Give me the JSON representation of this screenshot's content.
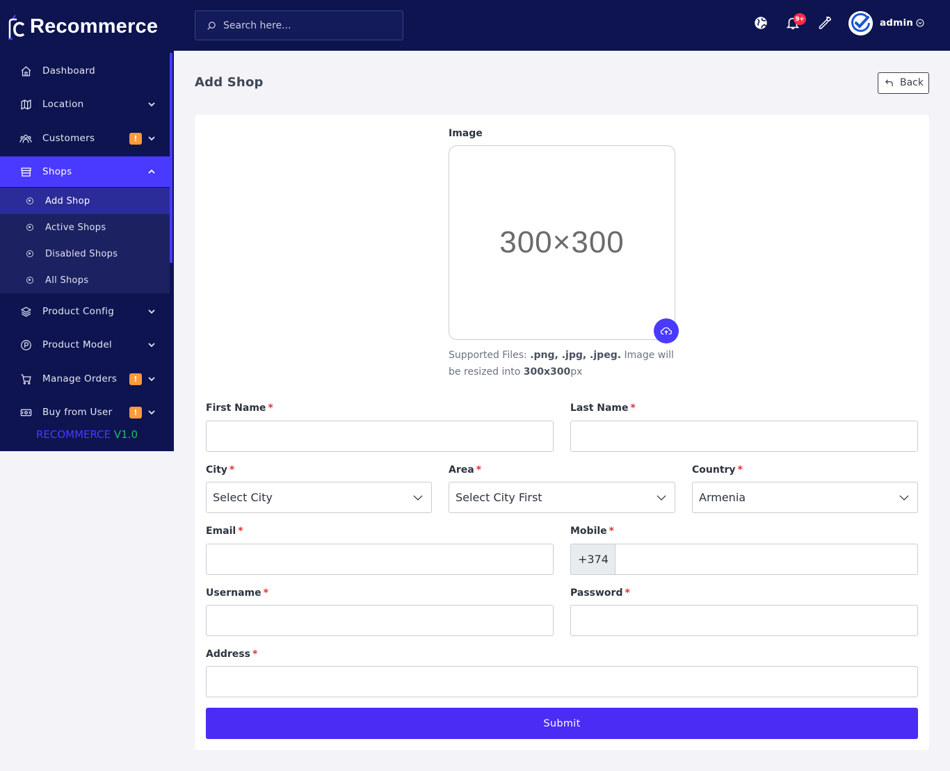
{
  "app": {
    "brand": "Recommerce",
    "version_name": "RECOMMERCE",
    "version_number": "V1.0"
  },
  "colors": {
    "sidebar_bg": "#0d1450",
    "accent": "#4a3aff",
    "badge": "#ff9a3c",
    "notification": "#ff2d4b",
    "version_green": "#1dbe6b"
  },
  "sidebar": {
    "items": [
      {
        "label": "Dashboard",
        "icon": "home-icon"
      },
      {
        "label": "Location",
        "icon": "map-icon"
      },
      {
        "label": "Customers",
        "icon": "users-icon",
        "badge": "!"
      },
      {
        "label": "Shops",
        "icon": "store-icon"
      },
      {
        "label": "Product Config",
        "icon": "layers-icon"
      },
      {
        "label": "Product Model",
        "icon": "p-circle-icon"
      },
      {
        "label": "Manage Orders",
        "icon": "cart-icon",
        "badge": "!"
      },
      {
        "label": "Buy from User",
        "icon": "cash-icon",
        "badge": "!"
      }
    ],
    "shops_submenu": [
      {
        "label": "Add Shop"
      },
      {
        "label": "Active Shops"
      },
      {
        "label": "Disabled Shops"
      },
      {
        "label": "All Shops"
      }
    ]
  },
  "header": {
    "search_placeholder": "Search here...",
    "notification_count": "9+",
    "user_name": "admin"
  },
  "page": {
    "title": "Add Shop",
    "back_label": "Back"
  },
  "form": {
    "image_label": "Image",
    "image_placeholder": "300×300",
    "supported_prefix": "Supported Files: ",
    "supported_types": ".png, .jpg, .jpeg.",
    "supported_middle": " Image will be resized into ",
    "supported_size": "300x300",
    "supported_suffix": "px",
    "required_mark": "*",
    "first_name_label": "First Name",
    "last_name_label": "Last Name",
    "city_label": "City",
    "city_value": "Select City",
    "area_label": "Area",
    "area_value": "Select City First",
    "country_label": "Country",
    "country_value": "Armenia",
    "email_label": "Email",
    "mobile_label": "Mobile",
    "mobile_prefix": "+374",
    "username_label": "Username",
    "password_label": "Password",
    "address_label": "Address",
    "submit_label": "Submit"
  }
}
